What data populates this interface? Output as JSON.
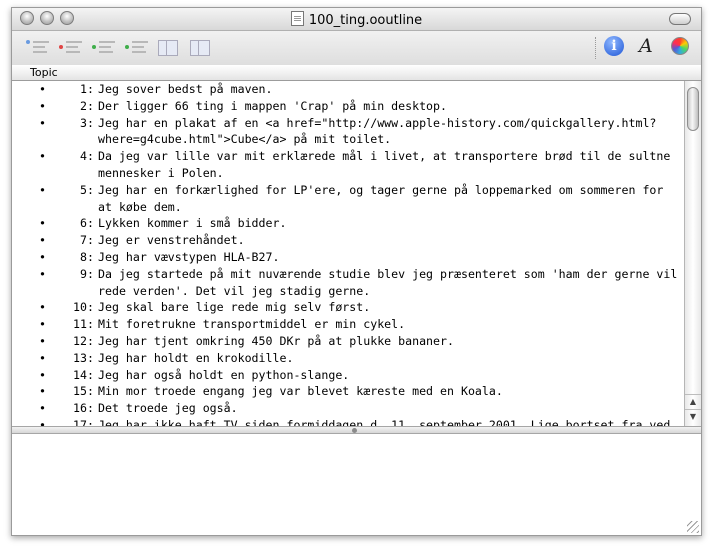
{
  "window": {
    "title": "100_ting.ooutline"
  },
  "header": {
    "column": "Topic"
  },
  "icons": {
    "doc": "document-icon",
    "info": "info-icon",
    "font": "font-icon",
    "color": "color-wheel-icon"
  },
  "toolbar": {
    "info_glyph": "i",
    "font_glyph": "A"
  },
  "outline": {
    "bullet": "•",
    "items": [
      {
        "num": "1:",
        "text": "Jeg sover bedst på maven."
      },
      {
        "num": "2:",
        "text": "Der ligger 66 ting i mappen 'Crap' på min desktop."
      },
      {
        "num": "3:",
        "text": "Jeg har en plakat af en <a href=\"http://www.apple-history.com/quickgallery.html?where=g4cube.html\">Cube</a> på mit toilet."
      },
      {
        "num": "4:",
        "text": "Da jeg var lille var mit erklærede mål i livet, at transportere brød til de sultne mennesker i Polen."
      },
      {
        "num": "5:",
        "text": "Jeg har en forkærlighed for LP'ere, og tager gerne på loppemarked om sommeren for at købe dem."
      },
      {
        "num": "6:",
        "text": "Lykken kommer i små bidder."
      },
      {
        "num": "7:",
        "text": "Jeg er venstrehåndet."
      },
      {
        "num": "8:",
        "text": "Jeg har vævstypen HLA-B27."
      },
      {
        "num": "9:",
        "text": "Da jeg startede på mit nuværende studie blev jeg præsenteret som 'ham der gerne vil rede verden'. Det vil jeg stadig gerne."
      },
      {
        "num": "10:",
        "text": "Jeg skal bare lige rede mig selv først."
      },
      {
        "num": "11:",
        "text": "Mit foretrukne transportmiddel er min cykel."
      },
      {
        "num": "12:",
        "text": "Jeg har tjent omkring 450 DKr på at plukke bananer."
      },
      {
        "num": "13:",
        "text": "Jeg har holdt en krokodille."
      },
      {
        "num": "14:",
        "text": "Jeg har også holdt en python-slange."
      },
      {
        "num": "15:",
        "text": "Min mor troede engang jeg var blevet kæreste med en Koala."
      },
      {
        "num": "16:",
        "text": "Det troede jeg også."
      },
      {
        "num": "17:",
        "text": "Jeg har ikke haft TV siden formiddagen d. 11. september 2001. Lige bortset fra ved"
      }
    ]
  }
}
